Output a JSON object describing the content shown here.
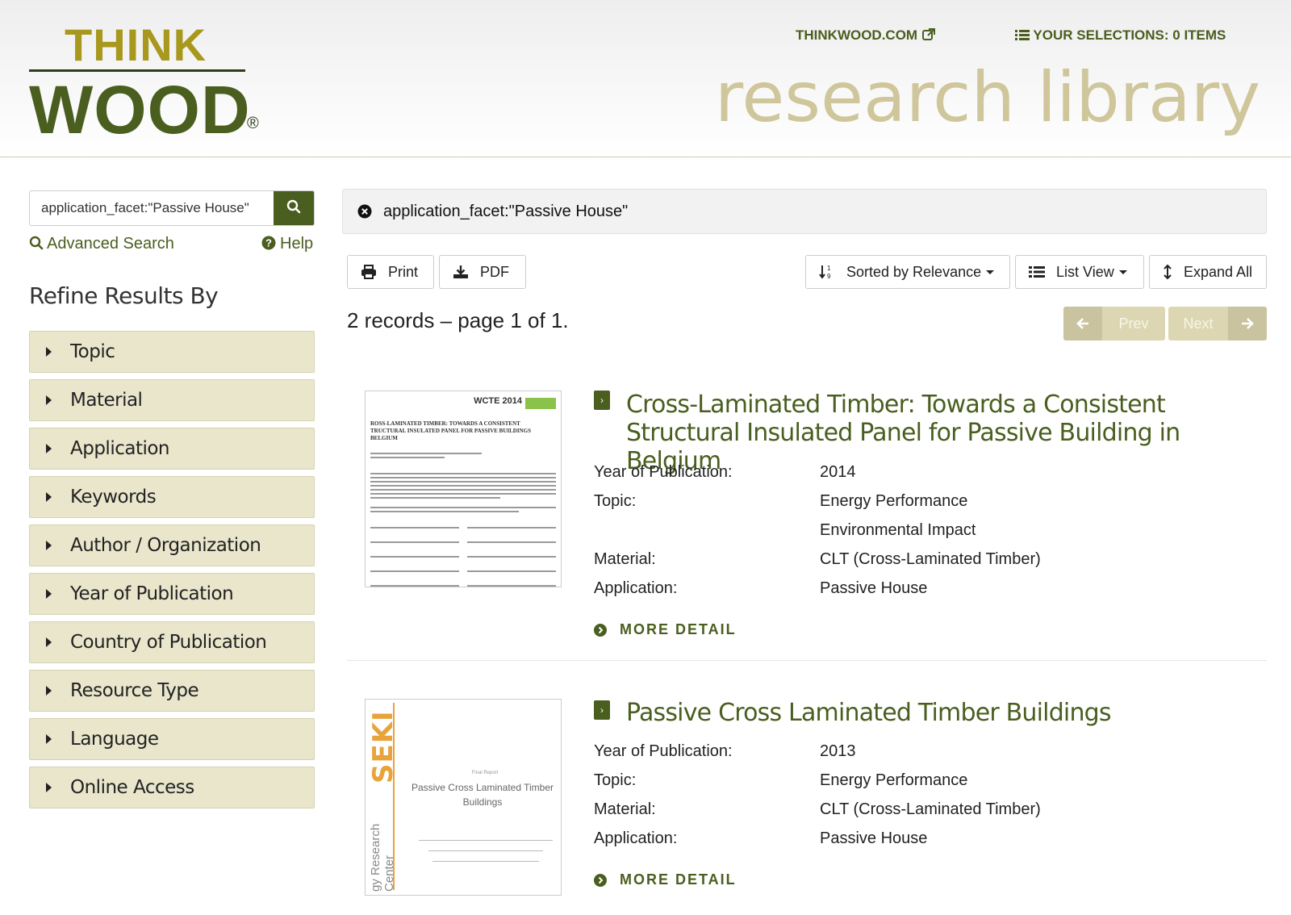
{
  "header": {
    "logo_top": "THINK",
    "logo_bottom": "WOOD",
    "logo_reg": "®",
    "site_link": "THINKWOOD.COM",
    "selections_link": "YOUR SELECTIONS: 0 ITEMS",
    "library_title": "research library"
  },
  "sidebar": {
    "search_value": "application_facet:\"Passive House\"",
    "advanced_search": "Advanced Search",
    "help": "Help",
    "refine_title": "Refine Results By",
    "facets": [
      {
        "label": "Topic"
      },
      {
        "label": "Material"
      },
      {
        "label": "Application"
      },
      {
        "label": "Keywords"
      },
      {
        "label": "Author / Organization"
      },
      {
        "label": "Year of Publication"
      },
      {
        "label": "Country of Publication"
      },
      {
        "label": "Resource Type"
      },
      {
        "label": "Language"
      },
      {
        "label": "Online Access"
      }
    ]
  },
  "main": {
    "query": "application_facet:\"Passive House\"",
    "toolbar": {
      "print": "Print",
      "pdf": "PDF",
      "sort": "Sorted by Relevance",
      "view": "List View",
      "expand": "Expand All"
    },
    "records_count": "2 records – page 1 of 1.",
    "pager": {
      "prev": "Prev",
      "next": "Next"
    },
    "labels": {
      "year": "Year of Publication:",
      "topic": "Topic:",
      "material": "Material:",
      "application": "Application:",
      "more_detail": "MORE DETAIL"
    },
    "records": [
      {
        "title": "Cross-Laminated Timber: Towards a Consistent Structural Insulated Panel for Passive Building in Belgium",
        "year": "2014",
        "topics": [
          "Energy Performance",
          "Environmental Impact"
        ],
        "material": "CLT (Cross-Laminated Timber)",
        "application": "Passive House",
        "thumb": {
          "badge": "WCTE 2014",
          "heading": "ROSS-LAMINATED TIMBER: TOWARDS A CONSISTENT TRUCTURAL INSULATED PANEL FOR PASSIVE BUILDINGS BELGIUM"
        }
      },
      {
        "title": "Passive Cross Laminated Timber Buildings",
        "year": "2013",
        "topics": [
          "Energy Performance"
        ],
        "material": "CLT (Cross-Laminated Timber)",
        "application": "Passive House",
        "thumb": {
          "brand": "SEKI",
          "side_text": "gy Research Center",
          "title": "Passive Cross Laminated Timber Buildings",
          "report": "Final Report"
        }
      }
    ]
  },
  "colors": {
    "brand_green": "#4a5e1f",
    "brand_gold": "#a8981e",
    "library_title": "#cfc69b",
    "facet_bg": "#e9e6cc"
  }
}
